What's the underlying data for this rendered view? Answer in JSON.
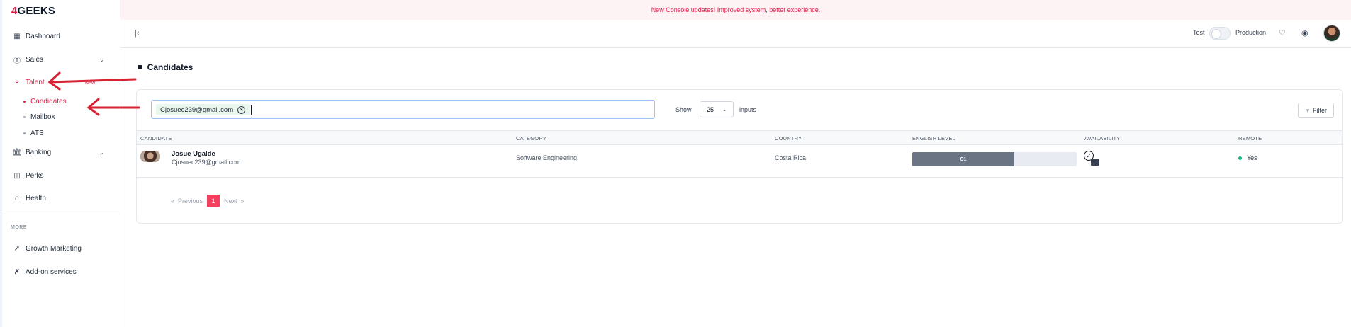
{
  "brand": {
    "logo_mark": "4",
    "logo_text": "GEEKS"
  },
  "banner": {
    "text": "New Console updates! Improved system, better experience."
  },
  "sidebar": {
    "items": [
      {
        "label": "Dashboard",
        "icon": "dashboard-icon"
      },
      {
        "label": "Sales",
        "icon": "dollar-icon",
        "expandable": true
      },
      {
        "label": "Talent",
        "icon": "talent-icon",
        "badge": "New",
        "active": true,
        "expandable": true
      },
      {
        "label": "Banking",
        "icon": "bank-icon",
        "expandable": true
      },
      {
        "label": "Perks",
        "icon": "gift-icon"
      },
      {
        "label": "Health",
        "icon": "home-icon"
      }
    ],
    "talent_sub": [
      {
        "label": "Candidates",
        "active": true
      },
      {
        "label": "Mailbox"
      },
      {
        "label": "ATS"
      }
    ],
    "more_label": "MORE",
    "more_items": [
      {
        "label": "Growth Marketing",
        "icon": "rocket-icon"
      },
      {
        "label": "Add-on services",
        "icon": "tools-icon"
      }
    ]
  },
  "topbar": {
    "env_test": "Test",
    "env_prod": "Production"
  },
  "page": {
    "title": "Candidates"
  },
  "search": {
    "chip_value": "Cjosuec239@gmail.com"
  },
  "table_controls": {
    "show_label": "Show",
    "page_size": "25",
    "inputs_label": "inputs",
    "filter_label": "Filter"
  },
  "table": {
    "headers": [
      "CANDIDATE",
      "CATEGORY",
      "COUNTRY",
      "ENGLISH LEVEL",
      "AVAILABILITY",
      "REMOTE"
    ],
    "rows": [
      {
        "name": "Josue Ugalde",
        "email": "Cjosuec239@gmail.com",
        "category": "Software Engineering",
        "country": "Costa Rica",
        "english_level": "C1",
        "english_level_fraction": 0.62,
        "remote": "Yes"
      }
    ]
  },
  "pagination": {
    "prev": "Previous",
    "current": "1",
    "next": "Next"
  },
  "colors": {
    "accent": "#e11d48",
    "level_bar": "#6b7482",
    "remote_dot": "#10b981"
  }
}
